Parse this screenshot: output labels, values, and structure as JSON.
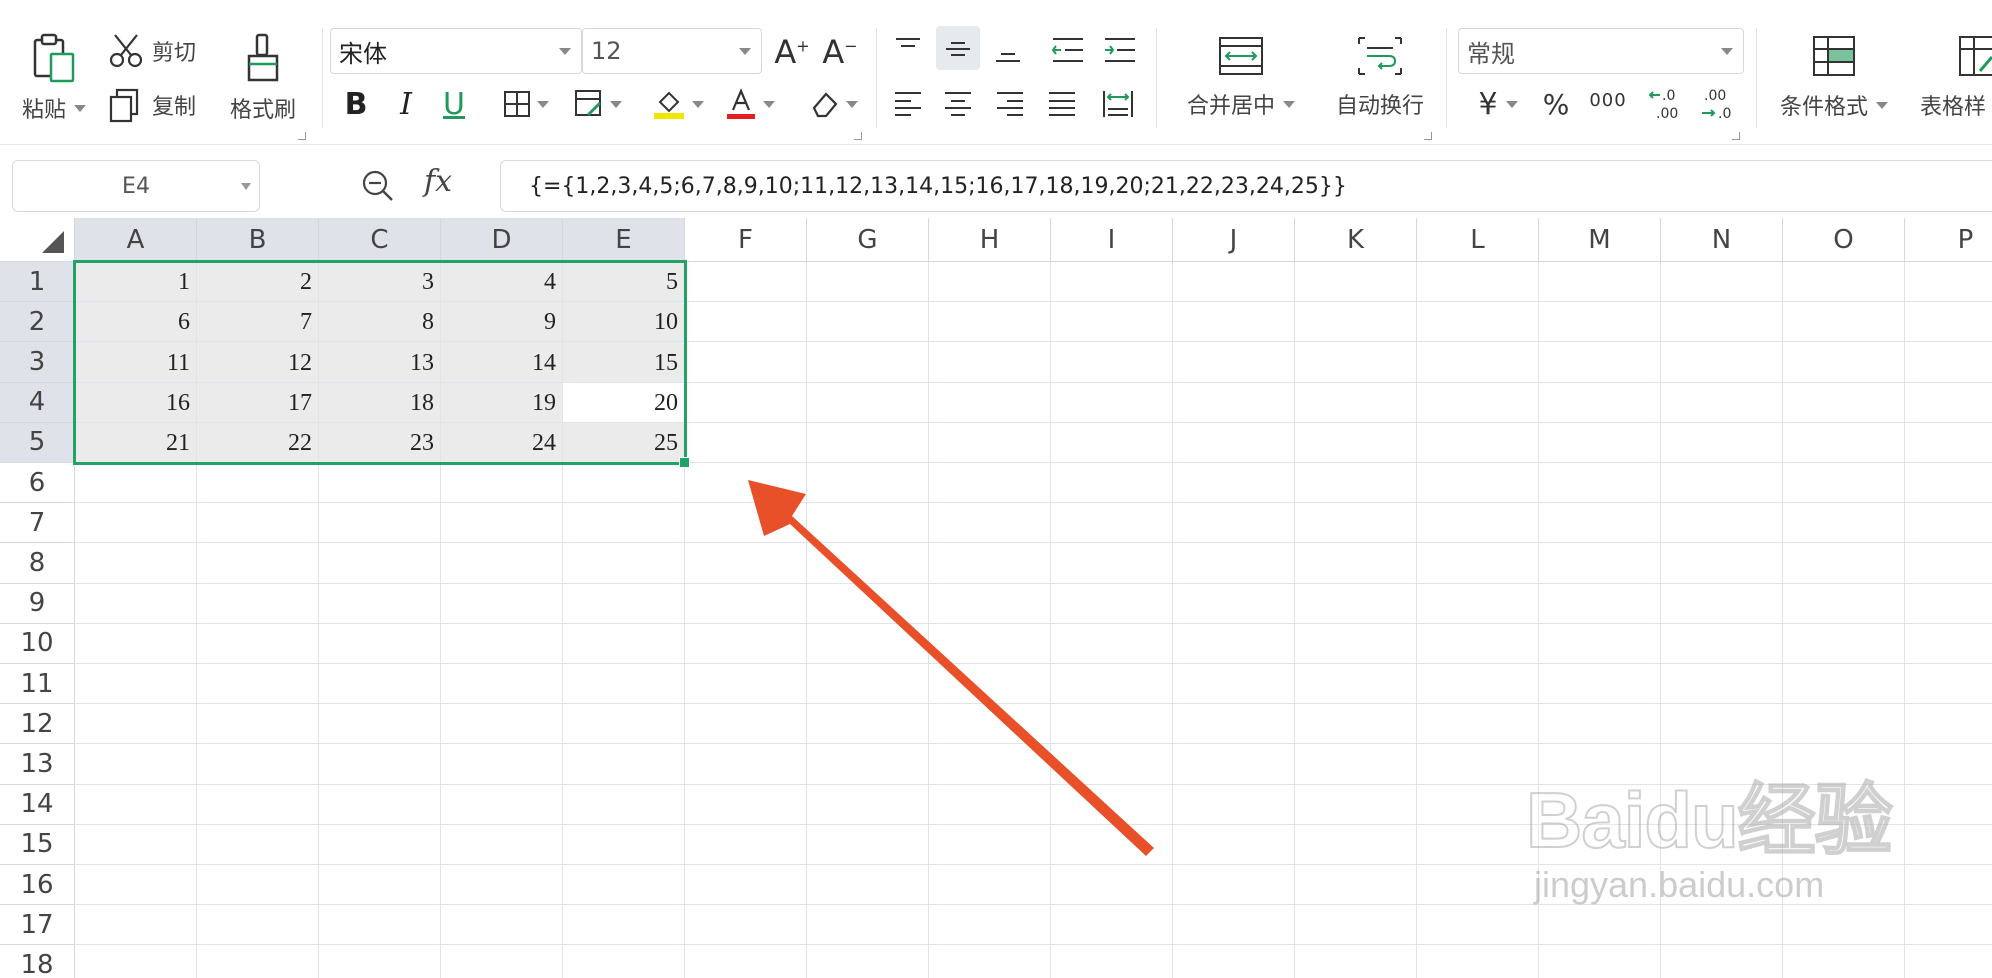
{
  "toolbar": {
    "paste": "粘贴",
    "cut": "剪切",
    "copy": "复制",
    "format_painter": "格式刷",
    "font_name": "宋体",
    "font_size": "12",
    "merge_center": "合并居中",
    "wrap_text": "自动换行",
    "number_format": "常规",
    "currency_symbol": "¥",
    "percent_symbol": "%",
    "thousands_symbol": "000",
    "conditional_format": "条件格式",
    "table_style": "表格样"
  },
  "formula_bar": {
    "name_box": "E4",
    "fx": "fx",
    "formula": "{={1,2,3,4,5;6,7,8,9,10;11,12,13,14,15;16,17,18,19,20;21,22,23,24,25}}"
  },
  "sheet": {
    "columns": [
      "A",
      "B",
      "C",
      "D",
      "E",
      "F",
      "G",
      "H",
      "I",
      "J",
      "K",
      "L",
      "M",
      "N",
      "O",
      "P"
    ],
    "rows": [
      "1",
      "2",
      "3",
      "4",
      "5",
      "6",
      "7",
      "8",
      "9",
      "10",
      "11",
      "12",
      "13",
      "14",
      "15",
      "16",
      "17",
      "18"
    ],
    "selected_range": "A1:E5",
    "active_cell": "E4",
    "cells": [
      [
        "1",
        "2",
        "3",
        "4",
        "5"
      ],
      [
        "6",
        "7",
        "8",
        "9",
        "10"
      ],
      [
        "11",
        "12",
        "13",
        "14",
        "15"
      ],
      [
        "16",
        "17",
        "18",
        "19",
        "20"
      ],
      [
        "21",
        "22",
        "23",
        "24",
        "25"
      ]
    ]
  },
  "colors": {
    "selection_border": "#21a366",
    "selection_fill": "#ebebeb",
    "header_selected": "#dfe2e8",
    "arrow": "#e8502a"
  },
  "watermark": {
    "main": "Baidu经验",
    "sub": "jingyan.baidu.com"
  }
}
